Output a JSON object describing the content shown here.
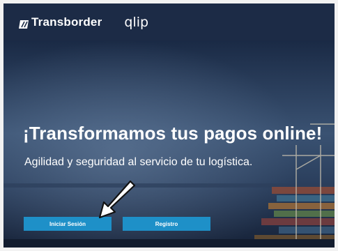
{
  "header": {
    "brand": "Transborder",
    "product": "qlip"
  },
  "hero": {
    "headline": "¡Transformamos tus pagos online!",
    "subheadline": "Agilidad y seguridad al servicio de tu logística."
  },
  "actions": {
    "login_label": "Iniciar Sesión",
    "register_label": "Registro"
  },
  "colors": {
    "header_bg": "#1c2b46",
    "button_bg": "#1e90c8",
    "text": "#ffffff"
  },
  "icons": {
    "brand_mark": "transborder-logo-mark",
    "pointer": "arrow-pointer-icon"
  }
}
